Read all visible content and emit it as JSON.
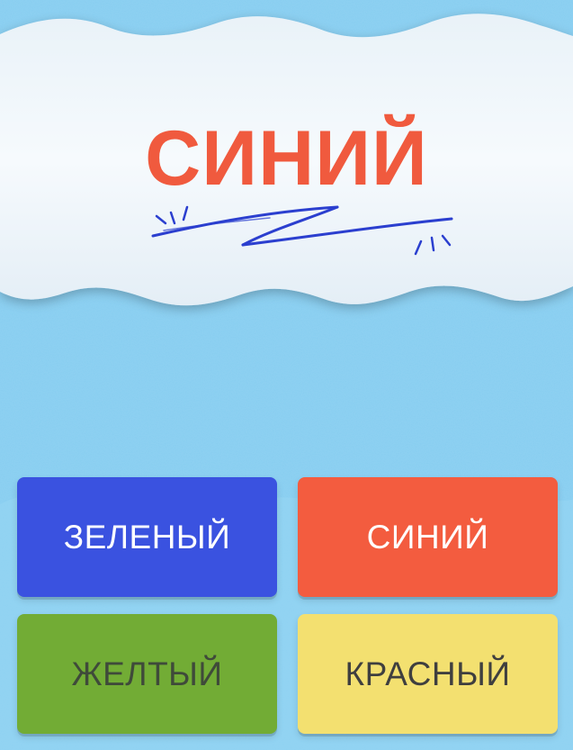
{
  "colors": {
    "sky": "#86cdf0",
    "cloud": "#f2f7fb",
    "blue": "#3a52e0",
    "red": "#f35c3f",
    "green": "#72ac35",
    "yellow": "#f3e070",
    "scribble": "#2b3fcf"
  },
  "prompt": {
    "word": "СИНИЙ",
    "color": "#f05a3e"
  },
  "answers": [
    {
      "label": "ЗЕЛЕНЫЙ",
      "background": "#3a52e0",
      "text_color": "#ffffff"
    },
    {
      "label": "СИНИЙ",
      "background": "#f35c3f",
      "text_color": "#ffffff"
    },
    {
      "label": "ЖЕЛТЫЙ",
      "background": "#72ac35",
      "text_color": "#3f4a3a"
    },
    {
      "label": "КРАСНЫЙ",
      "background": "#f3e070",
      "text_color": "#3f3f3f"
    }
  ]
}
